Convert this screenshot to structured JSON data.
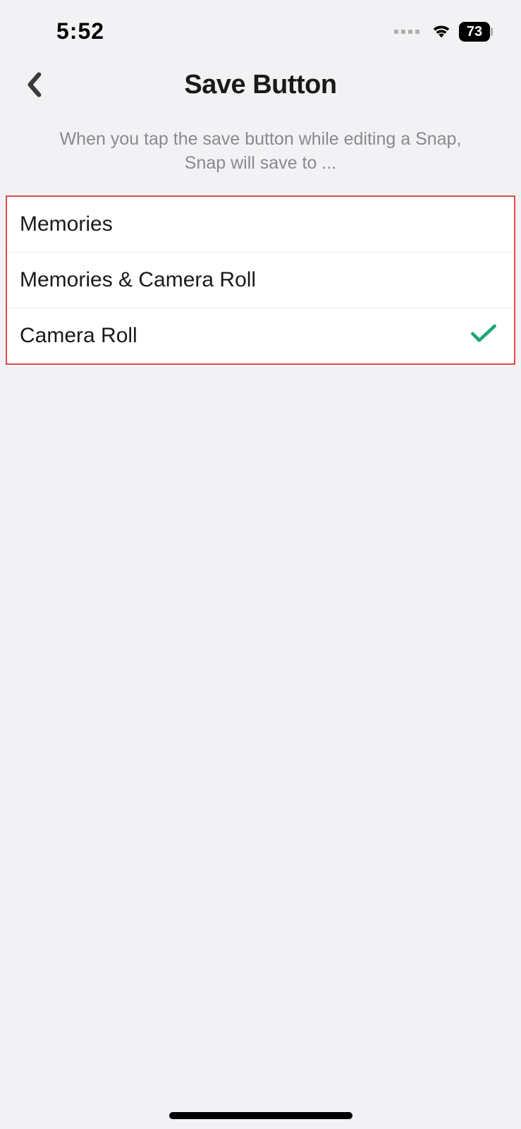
{
  "statusBar": {
    "time": "5:52",
    "battery": "73"
  },
  "header": {
    "title": "Save Button"
  },
  "description": "When you tap the save button while editing a Snap, Snap will save to ...",
  "options": [
    {
      "label": "Memories",
      "selected": false
    },
    {
      "label": "Memories & Camera Roll",
      "selected": false
    },
    {
      "label": "Camera Roll",
      "selected": true
    }
  ]
}
